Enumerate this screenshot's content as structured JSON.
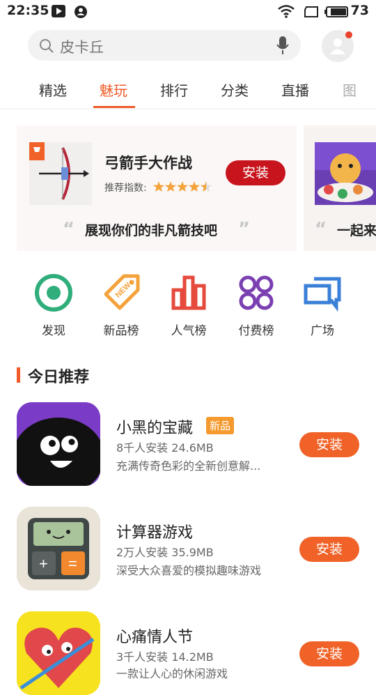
{
  "status": {
    "time": "22:35",
    "battery": "73"
  },
  "search": {
    "placeholder": "皮卡丘"
  },
  "tabs": [
    "精选",
    "魅玩",
    "排行",
    "分类",
    "直播",
    "图"
  ],
  "banner": {
    "title": "弓箭手大作战",
    "rating_label": "推荐指数:",
    "install": "安装",
    "tagline": "展现你们的非凡箭技吧",
    "next_tagline": "一起来"
  },
  "categories": [
    {
      "label": "发现",
      "color": "#2fae7c",
      "icon": "target-icon"
    },
    {
      "label": "新品榜",
      "color": "#f4a23a",
      "icon": "new-tag-icon"
    },
    {
      "label": "人气榜",
      "color": "#e54a3c",
      "icon": "bar-chart-icon"
    },
    {
      "label": "付费榜",
      "color": "#7a3fb1",
      "icon": "four-circles-icon"
    },
    {
      "label": "广场",
      "color": "#3a7fd8",
      "icon": "chat-square-icon"
    }
  ],
  "section": {
    "title": "今日推荐"
  },
  "apps": [
    {
      "name": "小黑的宝藏",
      "badge": "新品",
      "meta": "8千人安装  24.6MB",
      "desc": "充满传奇色彩的全新创意解...",
      "install": "安装"
    },
    {
      "name": "计算器游戏",
      "meta": "2万人安装  35.9MB",
      "desc": "深受大众喜爱的模拟趣味游戏",
      "install": "安装"
    },
    {
      "name": "心痛情人节",
      "meta": "3千人安装  14.2MB",
      "desc": "一款让人心的休闲游戏",
      "install": "安装"
    }
  ],
  "colors": {
    "accent": "#f05a28",
    "install_red": "#c8151d",
    "install_orange": "#f06227"
  }
}
